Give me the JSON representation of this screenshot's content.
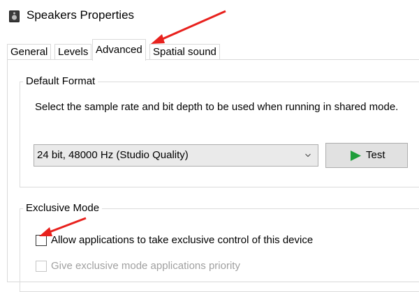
{
  "window": {
    "title": "Speakers Properties",
    "icon": "speaker-icon"
  },
  "tabs": [
    {
      "label": "General",
      "active": false
    },
    {
      "label": "Levels",
      "active": false
    },
    {
      "label": "Advanced",
      "active": true
    },
    {
      "label": "Spatial sound",
      "active": false
    }
  ],
  "default_format": {
    "group_title": "Default Format",
    "description": "Select the sample rate and bit depth to be used when running in shared mode.",
    "selected_format": "24 bit, 48000 Hz (Studio Quality)",
    "test_label": "Test"
  },
  "exclusive_mode": {
    "group_title": "Exclusive Mode",
    "allow_label": "Allow applications to take exclusive control of this device",
    "allow_checked": false,
    "priority_label": "Give exclusive mode applications priority",
    "priority_checked": false,
    "priority_disabled": true
  },
  "annotations": {
    "arrow_color": "#e8211d"
  },
  "colors": {
    "play_green": "#1e9e3a"
  }
}
